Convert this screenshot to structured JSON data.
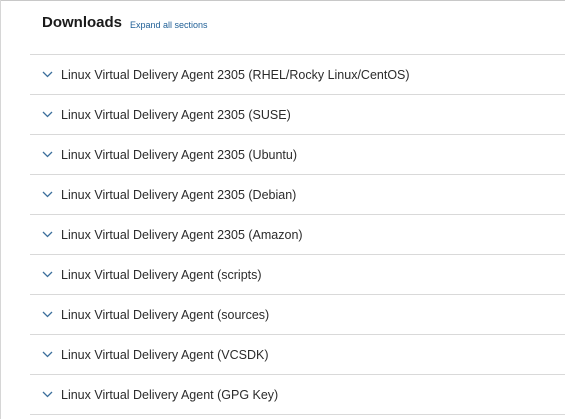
{
  "header": {
    "title": "Downloads",
    "expand_link": "Expand all sections"
  },
  "sections": [
    {
      "label": "Linux Virtual Delivery Agent 2305 (RHEL/Rocky Linux/CentOS)"
    },
    {
      "label": "Linux Virtual Delivery Agent 2305 (SUSE)"
    },
    {
      "label": "Linux Virtual Delivery Agent 2305 (Ubuntu)"
    },
    {
      "label": "Linux Virtual Delivery Agent 2305 (Debian)"
    },
    {
      "label": "Linux Virtual Delivery Agent 2305 (Amazon)"
    },
    {
      "label": "Linux Virtual Delivery Agent (scripts)"
    },
    {
      "label": "Linux Virtual Delivery Agent (sources)"
    },
    {
      "label": "Linux Virtual Delivery Agent (VCSDK)"
    },
    {
      "label": "Linux Virtual Delivery Agent (GPG Key)"
    }
  ],
  "icons": {
    "section_toggle": "chevron-down-icon"
  },
  "colors": {
    "link": "#1f5f96",
    "chevron": "#3c6f9c",
    "divider": "#d9d9d9"
  }
}
